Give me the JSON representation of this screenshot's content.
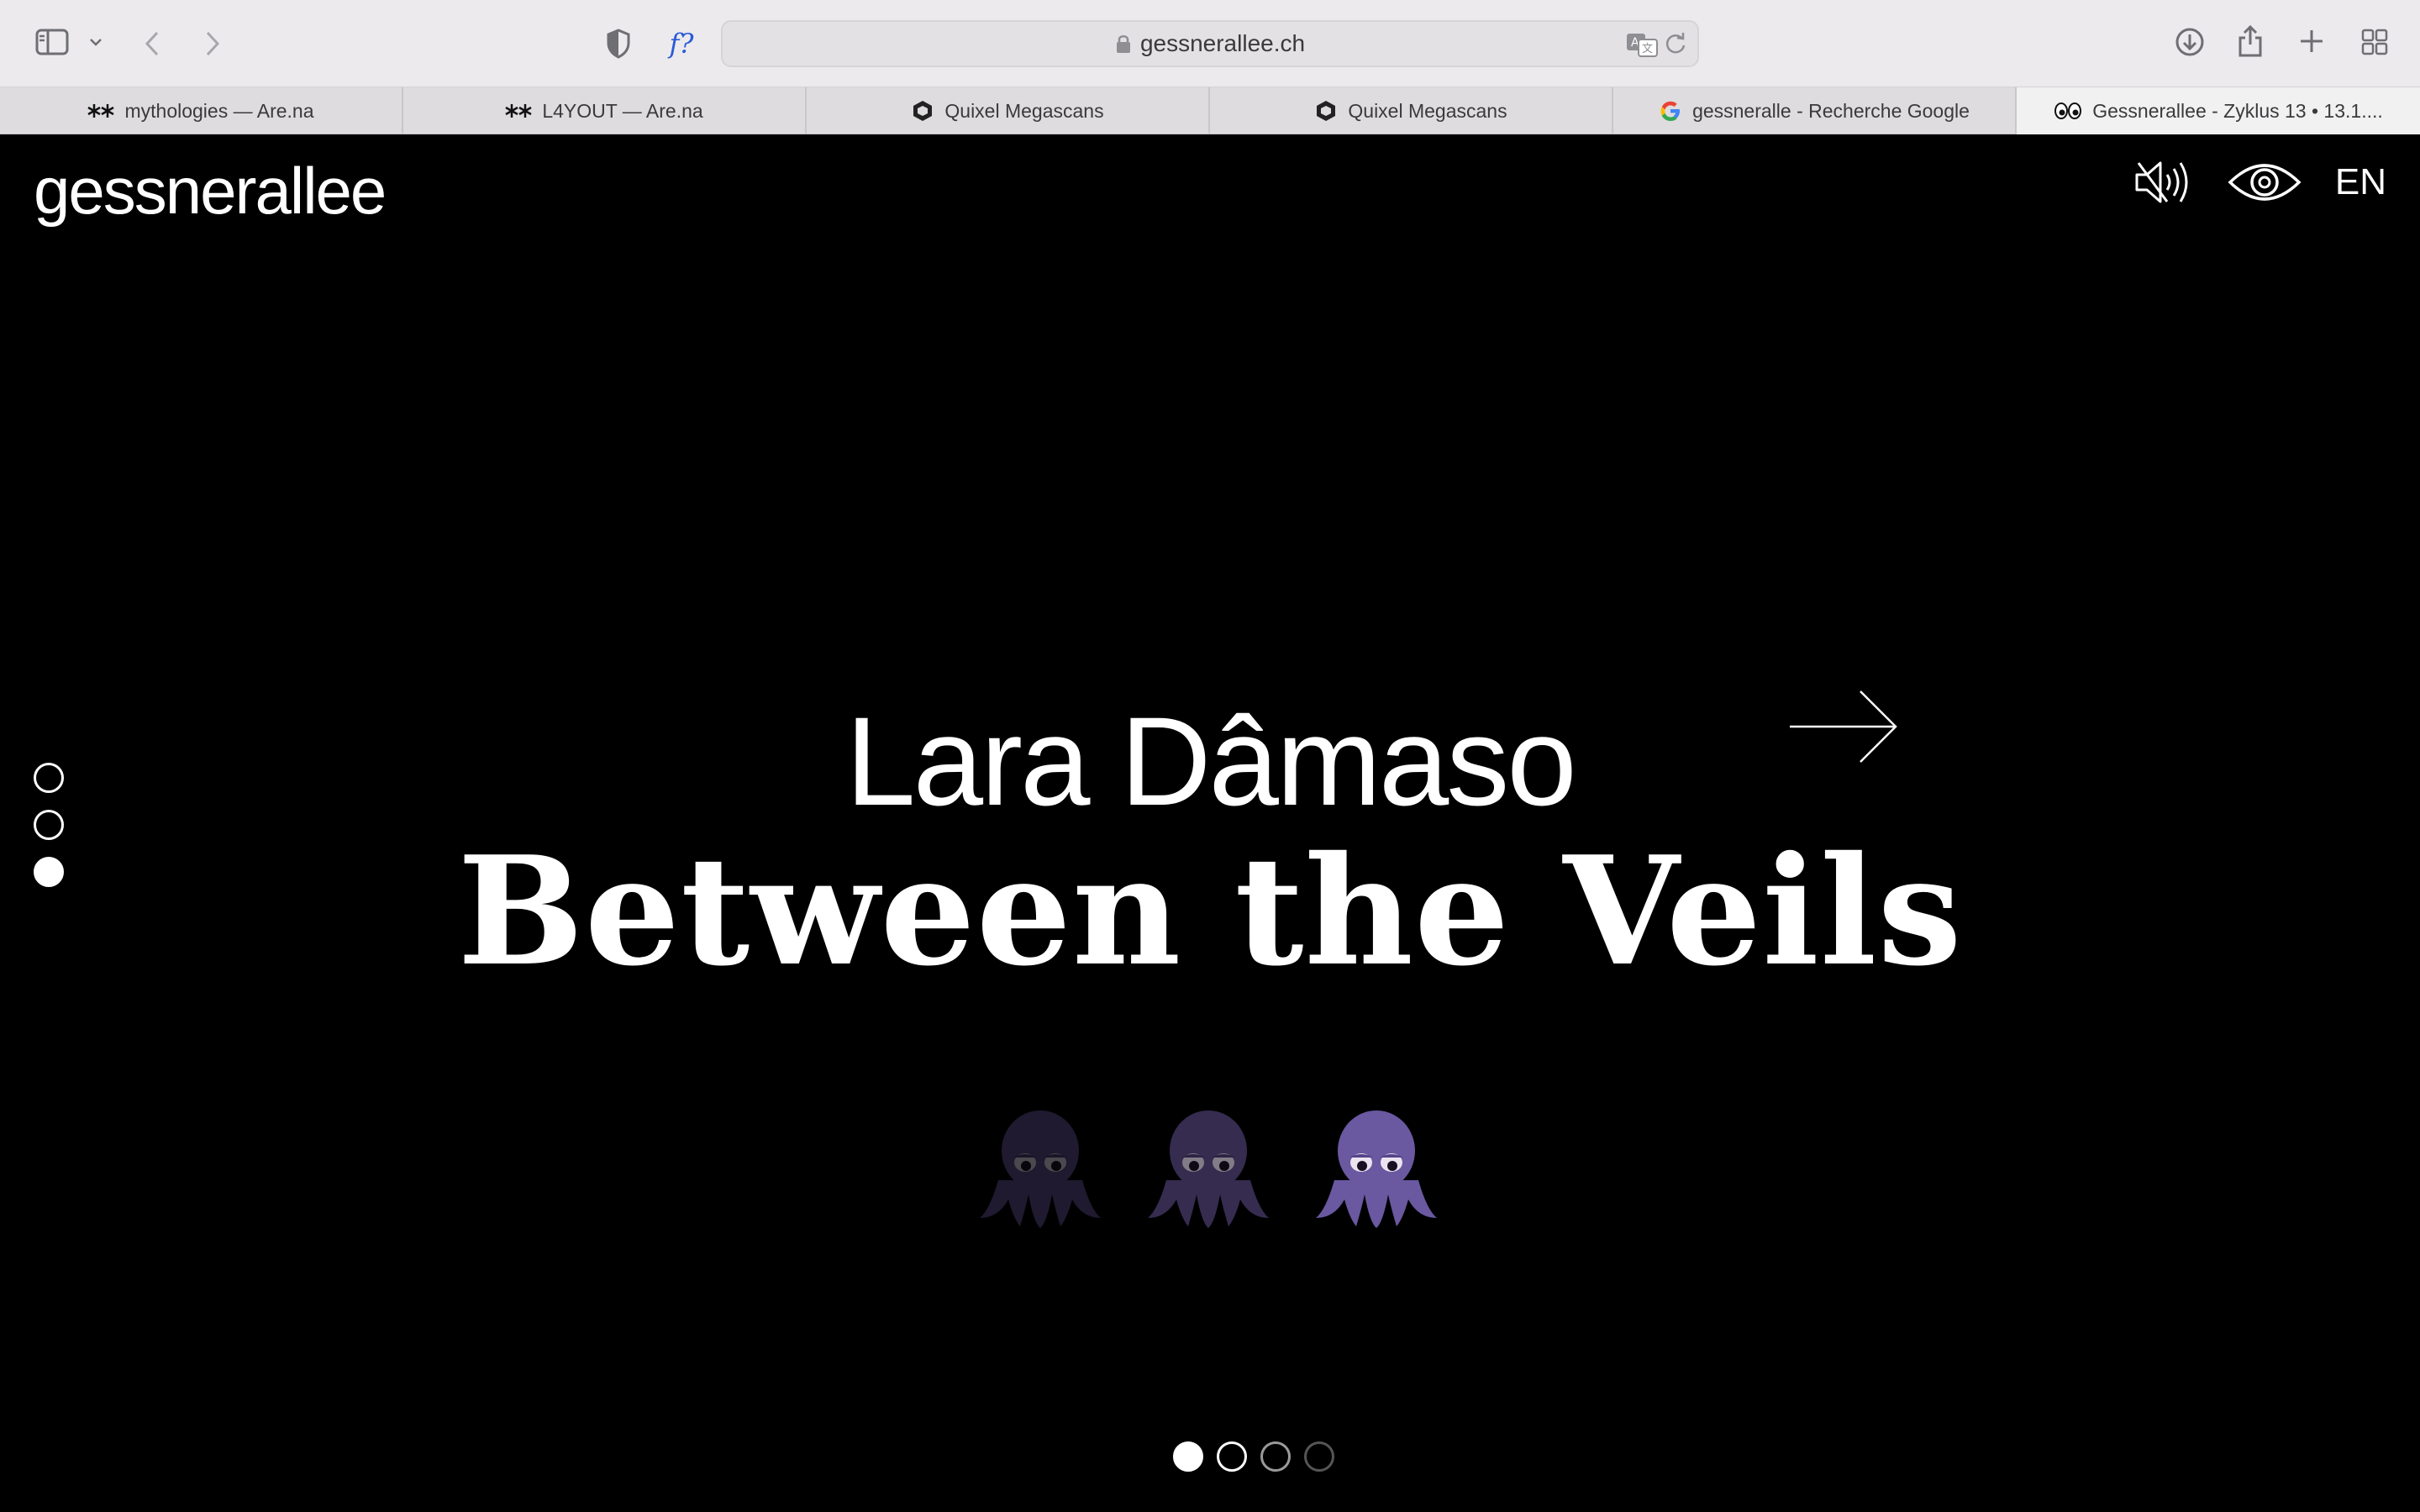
{
  "browser": {
    "url": "gessnerallee.ch",
    "icons": [
      "sidebar-icon",
      "chevron-down-icon",
      "back-icon",
      "forward-icon",
      "shield-icon",
      "font-icon",
      "lock-icon",
      "translate-icon",
      "reload-icon",
      "download-icon",
      "share-icon",
      "plus-icon",
      "grid-icon"
    ],
    "font_button_label": "f?"
  },
  "tabs": [
    {
      "label": "mythologies — Are.na",
      "icon": "arena-icon"
    },
    {
      "label": "L4YOUT — Are.na",
      "icon": "arena-icon"
    },
    {
      "label": "Quixel Megascans",
      "icon": "quixel-icon"
    },
    {
      "label": "Quixel Megascans",
      "icon": "quixel-icon"
    },
    {
      "label": "gessneralle - Recherche Google",
      "icon": "google-icon"
    },
    {
      "label": "Gessnerallee - Zyklus 13 • 13.1....",
      "icon": "eyes-icon",
      "active": true
    }
  ],
  "site": {
    "logo": "gessnerallee",
    "language": "EN",
    "icons": [
      "mute-icon",
      "eye-icon"
    ]
  },
  "hero": {
    "artist": "Lara Dâmaso",
    "title": "Between the Veils",
    "decorations": [
      "octopus-icon",
      "octopus-icon",
      "octopus-icon"
    ]
  },
  "side_nav": {
    "count": 3,
    "active_index": 2
  },
  "slider": {
    "count": 4,
    "active_index": 0
  },
  "colors": {
    "background": "#000000",
    "foreground": "#ffffff",
    "toolbar": "#eceaec",
    "octopus": "#5b4a86"
  }
}
